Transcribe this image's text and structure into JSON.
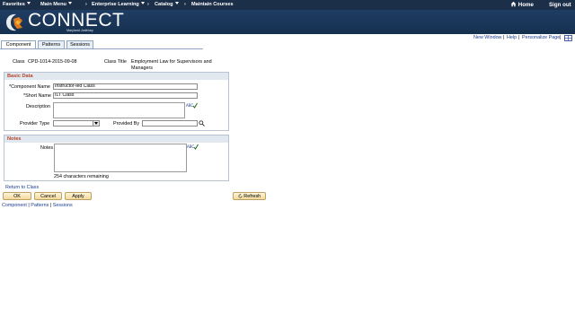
{
  "topnav": {
    "favorites": "Favorites",
    "main_menu": "Main Menu",
    "enterprise_learning": "Enterprise Learning",
    "catalog": "Catalog",
    "maintain_courses": "Maintain Courses",
    "home": "Home",
    "sign_out": "Sign out"
  },
  "banner": {
    "logo_text": "CONNECT",
    "logo_subtitle": "Maryland Judiciary"
  },
  "utility_links": {
    "new_window": "New Window",
    "help": "Help",
    "personalize_page": "Personalize Page",
    "separator": "|"
  },
  "tabs": [
    {
      "label": "Component",
      "active": true
    },
    {
      "label": "Patterns",
      "active": false
    },
    {
      "label": "Sessions",
      "active": false
    }
  ],
  "header_fields": {
    "class_label": "Class",
    "class_value": "CPD-1014-2015-09-08",
    "class_title_label": "Class Title",
    "class_title_line1": "Employment Law for Supervisors and",
    "class_title_line2": "Managers"
  },
  "basic_data": {
    "section_title": "Basic Data",
    "component_name_label": "*Component Name",
    "component_name_value": "Instructor-led Class",
    "short_name_label": "*Short Name",
    "short_name_value": "ILT Class",
    "description_label": "Description",
    "provider_type_label": "Provider Type",
    "provided_by_label": "Provided By"
  },
  "notes": {
    "section_title": "Notes",
    "notes_label": "Notes",
    "chars_remaining": "254 characters remaining"
  },
  "actions": {
    "return_link": "Return to Class",
    "ok": "OK",
    "cancel": "Cancel",
    "apply": "Apply",
    "refresh": "Refresh"
  },
  "bottom_links": {
    "component": "Component",
    "patterns": "Patterns",
    "sessions": "Sessions",
    "separator": " | "
  },
  "colors": {
    "nav_bg": "#1c2f48",
    "banner_bg": "#1f3d63",
    "section_title": "#b0452a",
    "link": "#1a3d8f",
    "button_bg": "#f3d99b"
  }
}
